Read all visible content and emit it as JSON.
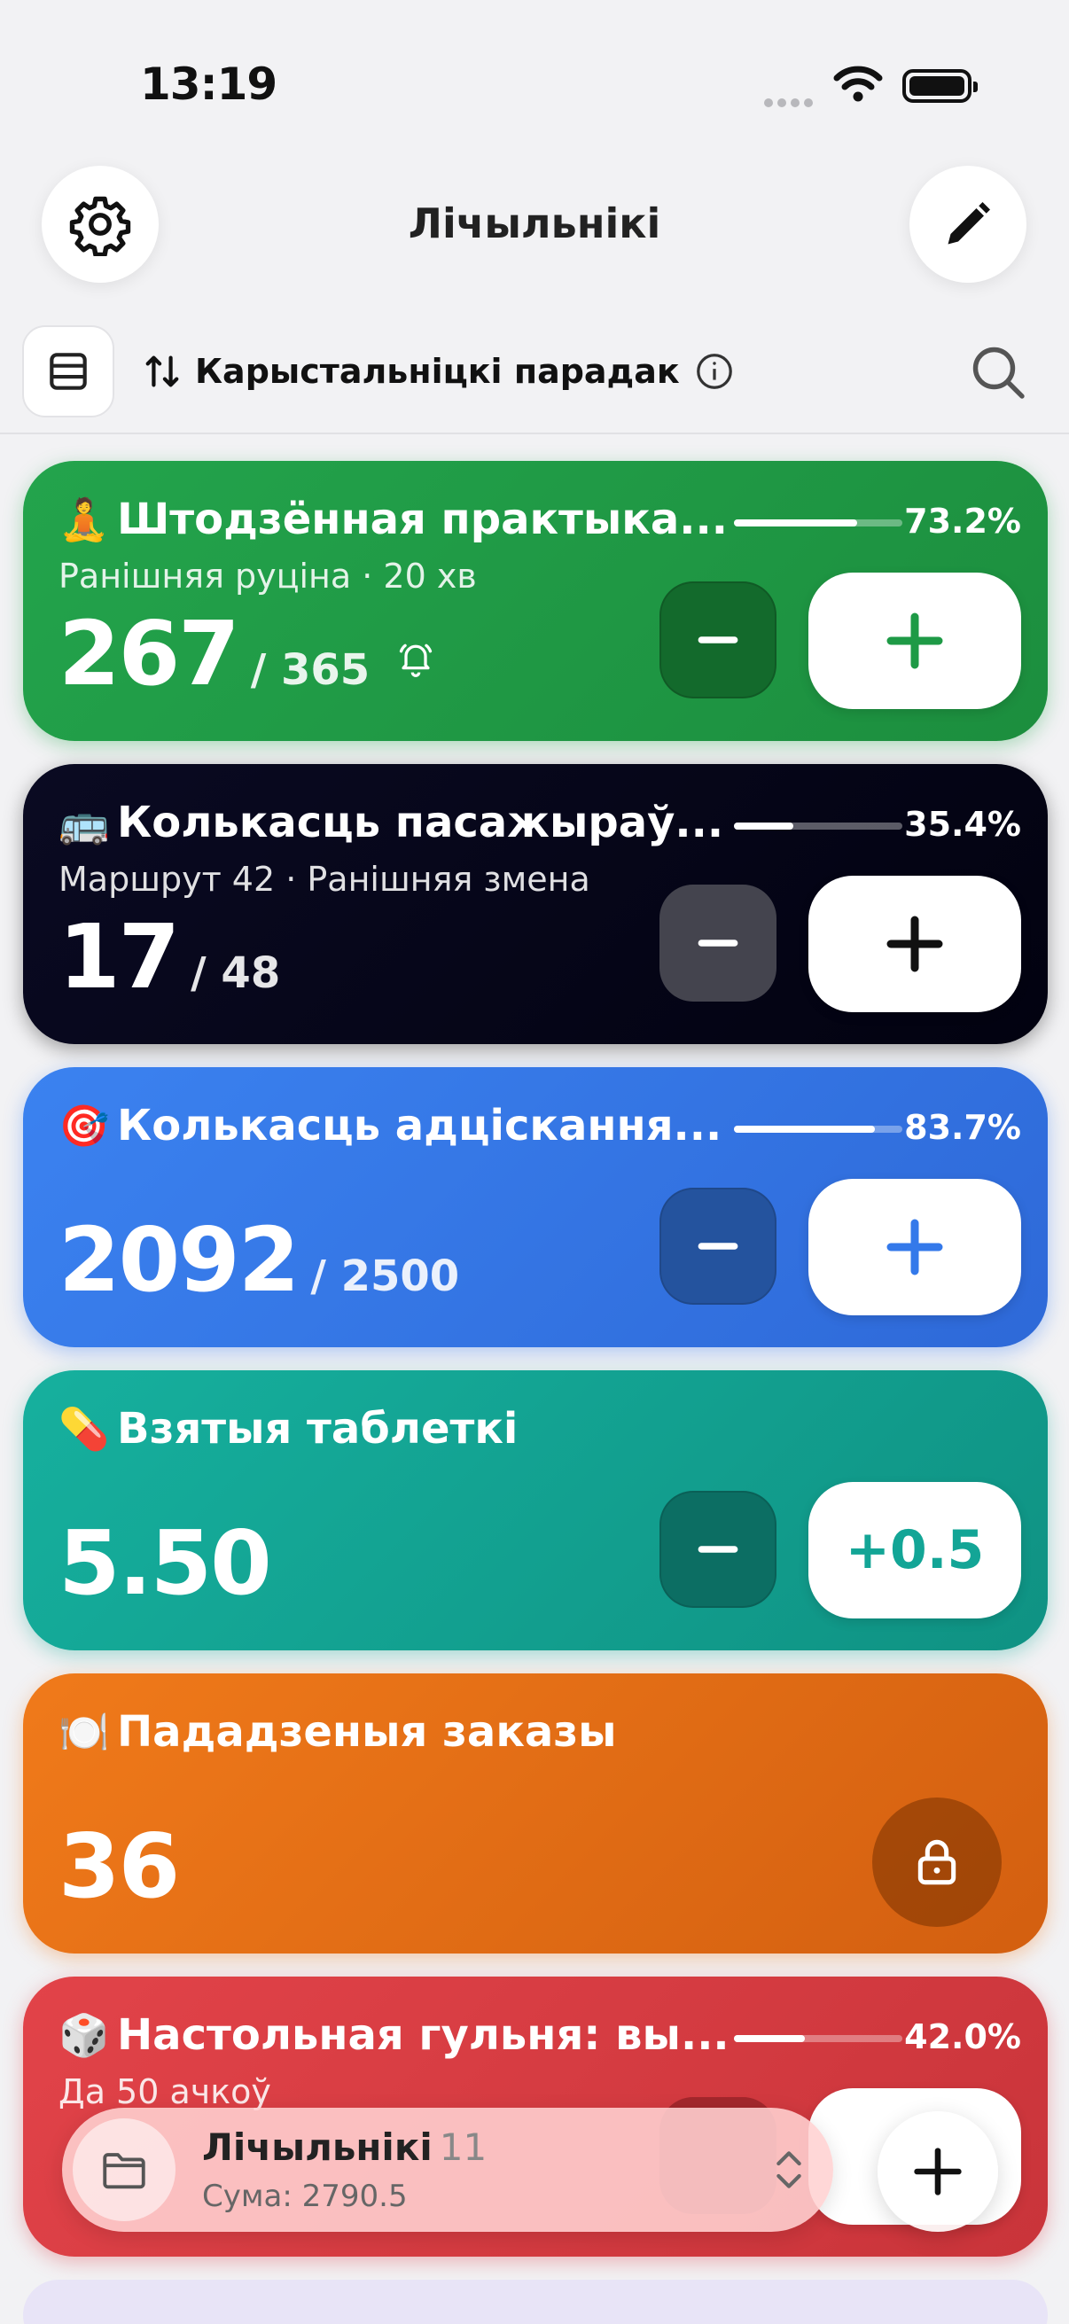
{
  "status": {
    "time": "13:19"
  },
  "nav": {
    "title": "Лічыльнікі"
  },
  "toolbar": {
    "sort_label": "Карыстальніцкі парадак"
  },
  "colors": {
    "green": "#1e9a46",
    "navy": "#050516",
    "blue": "#3479ea",
    "teal": "#13a596",
    "orange": "#ec7114",
    "red": "#dc3a40"
  },
  "counters": [
    {
      "emoji": "🧘",
      "title": "Штодзённая практыка...",
      "subtitle": "Ранішняя руціна · 20 хв",
      "value": "267",
      "goal": "/ 365",
      "percent": "73.2%",
      "progress": 0.732,
      "plus_label": "+",
      "has_bell": true
    },
    {
      "emoji": "🚌",
      "title": "Колькасць пасажыраў...",
      "subtitle": "Маршрут 42 · Ранішняя змена",
      "value": "17",
      "goal": "/ 48",
      "percent": "35.4%",
      "progress": 0.354,
      "plus_label": "+"
    },
    {
      "emoji": "🎯",
      "title": "Колькасць адціскання...",
      "subtitle": "",
      "value": "2092",
      "goal": "/ 2500",
      "percent": "83.7%",
      "progress": 0.837,
      "plus_label": "+"
    },
    {
      "emoji": "💊",
      "title": "Взятыя таблеткі",
      "subtitle": "",
      "value": "5.50",
      "goal": "",
      "plus_label": "+0.5"
    },
    {
      "emoji": "🍽️",
      "title": "Пададзеныя заказы",
      "subtitle": "",
      "value": "36",
      "goal": "",
      "locked": true
    },
    {
      "emoji": "🎲",
      "title": "Настольная гульня: вы...",
      "subtitle": "Да 50 ачкоў",
      "value": "",
      "goal": "",
      "percent": "42.0%",
      "progress": 0.42,
      "plus_label": "+"
    }
  ],
  "bottom_bar": {
    "title": "Лічыльнікі",
    "count": "11",
    "sum": "Сума: 2790.5"
  }
}
